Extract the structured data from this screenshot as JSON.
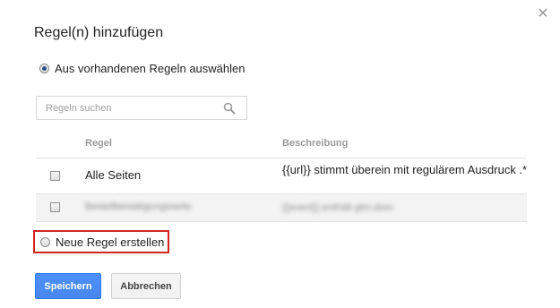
{
  "dialog": {
    "title": "Regel(n) hinzufügen",
    "close_icon": "close-icon",
    "close_glyph": "✕"
  },
  "options": {
    "existing_label": "Aus vorhandenen Regeln auswählen",
    "existing_selected": true,
    "new_label": "Neue Regel erstellen",
    "new_selected": false
  },
  "search": {
    "placeholder": "Regeln suchen",
    "value": "",
    "icon": "search-icon"
  },
  "table": {
    "columns": [
      "Regel",
      "Beschreibung"
    ],
    "rows": [
      {
        "rule": "Alle Seiten",
        "description": "{{url}} stimmt überein mit regulärem Ausdruck .*",
        "checked": false
      },
      {
        "rule": "Bestellbestätigungsseite",
        "description": "{{event}} enthält gtm.dom",
        "checked": false,
        "blurred": true
      }
    ]
  },
  "buttons": {
    "save_label": "Speichern",
    "cancel_label": "Abbrechen"
  },
  "colors": {
    "primary_button": "#4d90fe",
    "highlight_border": "#d22424"
  }
}
